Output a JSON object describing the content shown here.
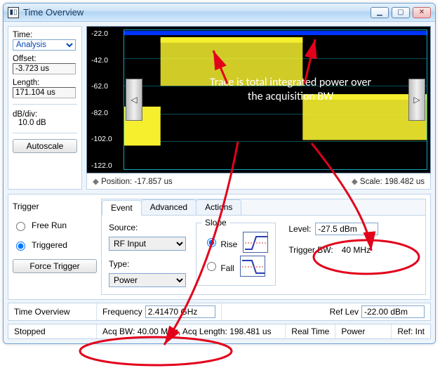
{
  "window": {
    "title": "Time Overview"
  },
  "side": {
    "time_label": "Time:",
    "time_options": [
      "Analysis"
    ],
    "time_value": "Analysis",
    "offset_label": "Offset:",
    "offset_value": "-3.723 us",
    "length_label": "Length:",
    "length_value": "171.104 us",
    "dbdiv_label": "dB/div:",
    "dbdiv_value": "10.0 dB",
    "autoscale_label": "Autoscale"
  },
  "yaxis": [
    "-22.0",
    "-42.0",
    "-62.0",
    "-82.0",
    "-102.0",
    "-122.0"
  ],
  "plot_status": {
    "position_label": "Position:",
    "position_value": "-17.857 us",
    "scale_label": "Scale:",
    "scale_value": "198.482 us"
  },
  "annotation": "Trace is total integrated power over the acquisition BW",
  "trigger": {
    "title": "Trigger",
    "free_run": "Free Run",
    "triggered": "Triggered",
    "force_label": "Force Trigger",
    "tabs": {
      "event": "Event",
      "advanced": "Advanced",
      "actions": "Actions"
    },
    "source_label": "Source:",
    "source_value": "RF Input",
    "type_label": "Type:",
    "type_value": "Power",
    "slope_label": "Slope",
    "rise": "Rise",
    "fall": "Fall",
    "level_label": "Level:",
    "level_value": "-27.5 dBm",
    "triggerbw_label": "Trigger BW:",
    "triggerbw_value": "40 MHz"
  },
  "bar1": {
    "overview": "Time Overview",
    "freq_label": "Frequency",
    "freq_value": "2.41470 GHz",
    "reflev_label": "Ref Lev",
    "reflev_value": "-22.00 dBm"
  },
  "bar2": {
    "state": "Stopped",
    "acq": "Acq BW: 40.00 MHz, Acq Length: 198.481 us",
    "realtime": "Real Time",
    "power": "Power",
    "ref": "Ref: Int"
  }
}
